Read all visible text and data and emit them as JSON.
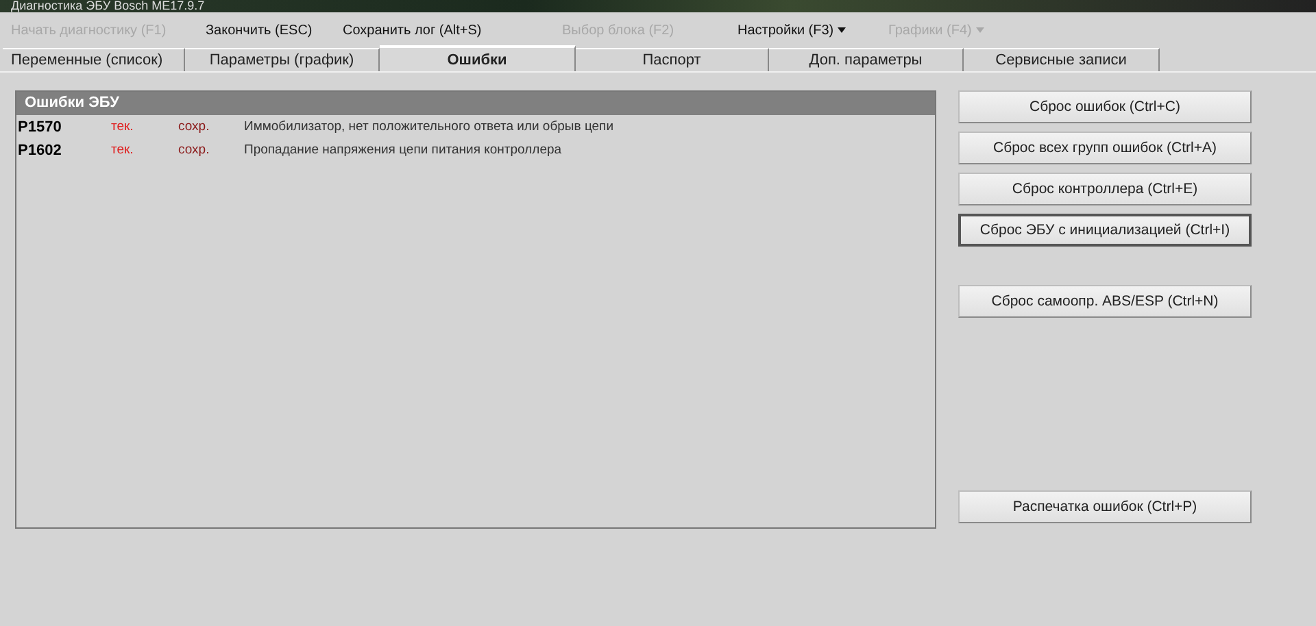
{
  "window": {
    "title": "Диагностика ЭБУ Bosch ME17.9.7"
  },
  "menu": [
    {
      "label": "Начать диагностику (F1)",
      "disabled": true,
      "dropdown": false
    },
    {
      "label": "Закончить (ESC)",
      "disabled": false,
      "dropdown": false
    },
    {
      "label": "Сохранить лог (Alt+S)",
      "disabled": false,
      "dropdown": false
    },
    {
      "label": "Выбор блока (F2)",
      "disabled": true,
      "dropdown": false
    },
    {
      "label": "Настройки (F3)",
      "disabled": false,
      "dropdown": true
    },
    {
      "label": "Графики (F4)",
      "disabled": true,
      "dropdown": true
    }
  ],
  "tabs": [
    {
      "label": "Переменные (список)",
      "selected": false
    },
    {
      "label": "Параметры (график)",
      "selected": false
    },
    {
      "label": "Ошибки",
      "selected": true
    },
    {
      "label": "Паспорт",
      "selected": false
    },
    {
      "label": "Доп. параметры",
      "selected": false
    },
    {
      "label": "Сервисные записи",
      "selected": false
    }
  ],
  "errors_panel": {
    "title": "Ошибки ЭБУ",
    "rows": [
      {
        "code": "P1570",
        "current": "тек.",
        "stored": "сохр.",
        "description": "Иммобилизатор, нет положительного ответа или обрыв цепи"
      },
      {
        "code": "P1602",
        "current": "тек.",
        "stored": "сохр.",
        "description": "Пропадание напряжения цепи питания контроллера"
      }
    ]
  },
  "button_groups": [
    {
      "buttons": [
        {
          "label": "Сброс ошибок (Ctrl+C)",
          "focused": false
        },
        {
          "label": "Сброс всех групп ошибок (Ctrl+A)",
          "focused": false
        },
        {
          "label": "Сброс контроллера (Ctrl+E)",
          "focused": false
        },
        {
          "label": "Сброс ЭБУ с инициализацией (Ctrl+I)",
          "focused": true
        }
      ]
    },
    {
      "buttons": [
        {
          "label": "Сброс самоопр. ABS/ESP (Ctrl+N)",
          "focused": false
        }
      ]
    },
    {
      "buttons": [
        {
          "label": "Распечатка ошибок (Ctrl+P)",
          "focused": false
        }
      ]
    }
  ]
}
